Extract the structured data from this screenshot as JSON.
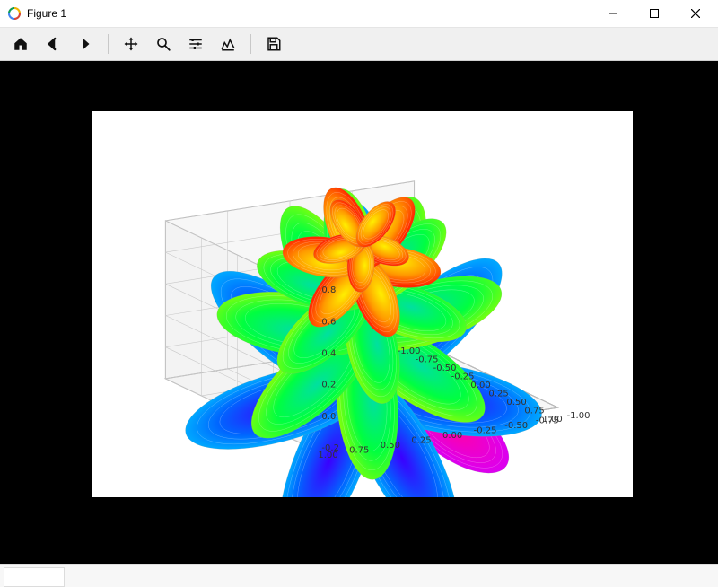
{
  "window": {
    "title": "Figure 1",
    "minimize_tooltip": "Minimize",
    "maximize_tooltip": "Maximize",
    "close_tooltip": "Close"
  },
  "toolbar": {
    "home": "Home",
    "back": "Back",
    "forward": "Forward",
    "pan": "Pan",
    "zoom": "Zoom",
    "subplots": "Configure subplots",
    "edit": "Edit axis, curve and image parameters",
    "save": "Save"
  },
  "chart_data": {
    "type": "surface3d",
    "description": "3D parametric 'rose' surface colored by height (rainbow/hsv colormap from purple at low z to red at high z). Multiple layered petal tiers.",
    "x_range": [
      -1.0,
      1.0
    ],
    "y_range": [
      -1.0,
      1.0
    ],
    "z_range": [
      -0.2,
      0.8
    ],
    "x_ticks": [
      "-1.00",
      "-0.75",
      "-0.50",
      "-0.25",
      "0.00",
      "0.25",
      "0.50",
      "0.75",
      "1.00"
    ],
    "y_ticks": [
      "-1.00",
      "-0.75",
      "-0.50",
      "-0.25",
      "0.00",
      "0.25",
      "0.50",
      "0.75",
      "1.00"
    ],
    "z_ticks": [
      "-0.2",
      "0.0",
      "0.2",
      "0.4",
      "0.6",
      "0.8"
    ],
    "colormap": "hsv",
    "elev_deg_est": 30,
    "azim_deg_est": -60
  },
  "colors": {
    "toolbar_bg": "#f0f0f0",
    "canvas_bg": "#000000",
    "figure_bg": "#ffffff",
    "grid": "#b8b8b8"
  }
}
